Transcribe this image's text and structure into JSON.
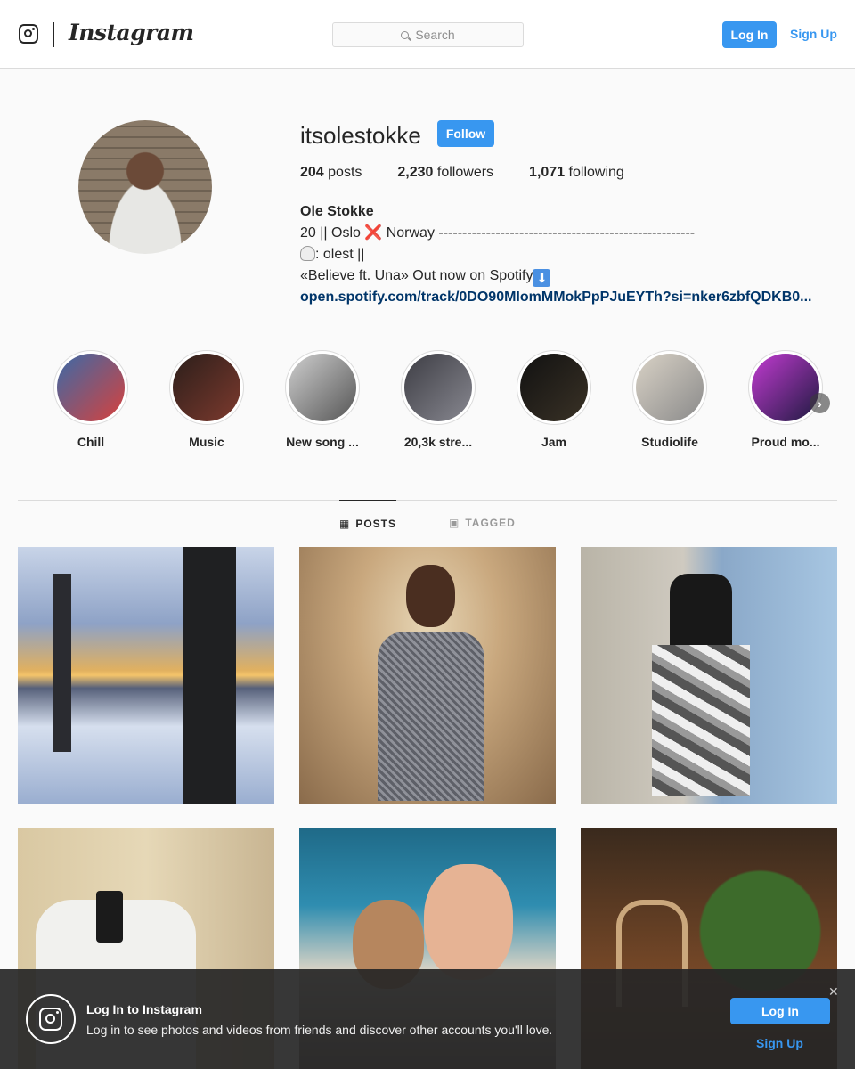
{
  "header": {
    "wordmark": "Instagram",
    "search_placeholder": "Search",
    "login_label": "Log In",
    "signup_label": "Sign Up"
  },
  "profile": {
    "username": "itsolestokke",
    "follow_label": "Follow",
    "stats": {
      "posts_count": "204",
      "posts_label": "posts",
      "followers_count": "2,230",
      "followers_label": "followers",
      "following_count": "1,071",
      "following_label": "following"
    },
    "bio": {
      "name": "Ole Stokke",
      "line1_a": "20 || Oslo ",
      "line1_x": "❌",
      "line1_b": " Norway ------------------------------------------------------",
      "line2": ": olest ||",
      "line3": "«Believe ft. Una» Out now on Spotify",
      "line3_arrow": "⬇",
      "link": "open.spotify.com/track/0DO90MIomMMokPpPJuEYTh?si=nker6zbfQDKB0..."
    }
  },
  "highlights": [
    {
      "label": "Chill",
      "color_a": "#3a6aa8",
      "color_b": "#d8413c"
    },
    {
      "label": "Music",
      "color_a": "#2b1e1a",
      "color_b": "#7d3a2e"
    },
    {
      "label": "New song ...",
      "color_a": "#cfcfcf",
      "color_b": "#555555"
    },
    {
      "label": "20,3k stre...",
      "color_a": "#3d3d44",
      "color_b": "#888890"
    },
    {
      "label": "Jam",
      "color_a": "#111111",
      "color_b": "#3a3226"
    },
    {
      "label": "Studiolife",
      "color_a": "#d9d2c6",
      "color_b": "#8a8a8a"
    },
    {
      "label": "Proud mo...",
      "color_a": "#c23bd1",
      "color_b": "#1e1a40"
    }
  ],
  "tabs": {
    "posts_label": "POSTS",
    "tagged_label": "TAGGED"
  },
  "banner": {
    "title": "Log In to Instagram",
    "text": "Log in to see photos and videos from friends and discover other accounts you'll love.",
    "login_label": "Log In",
    "signup_label": "Sign Up",
    "close_label": "✕"
  }
}
